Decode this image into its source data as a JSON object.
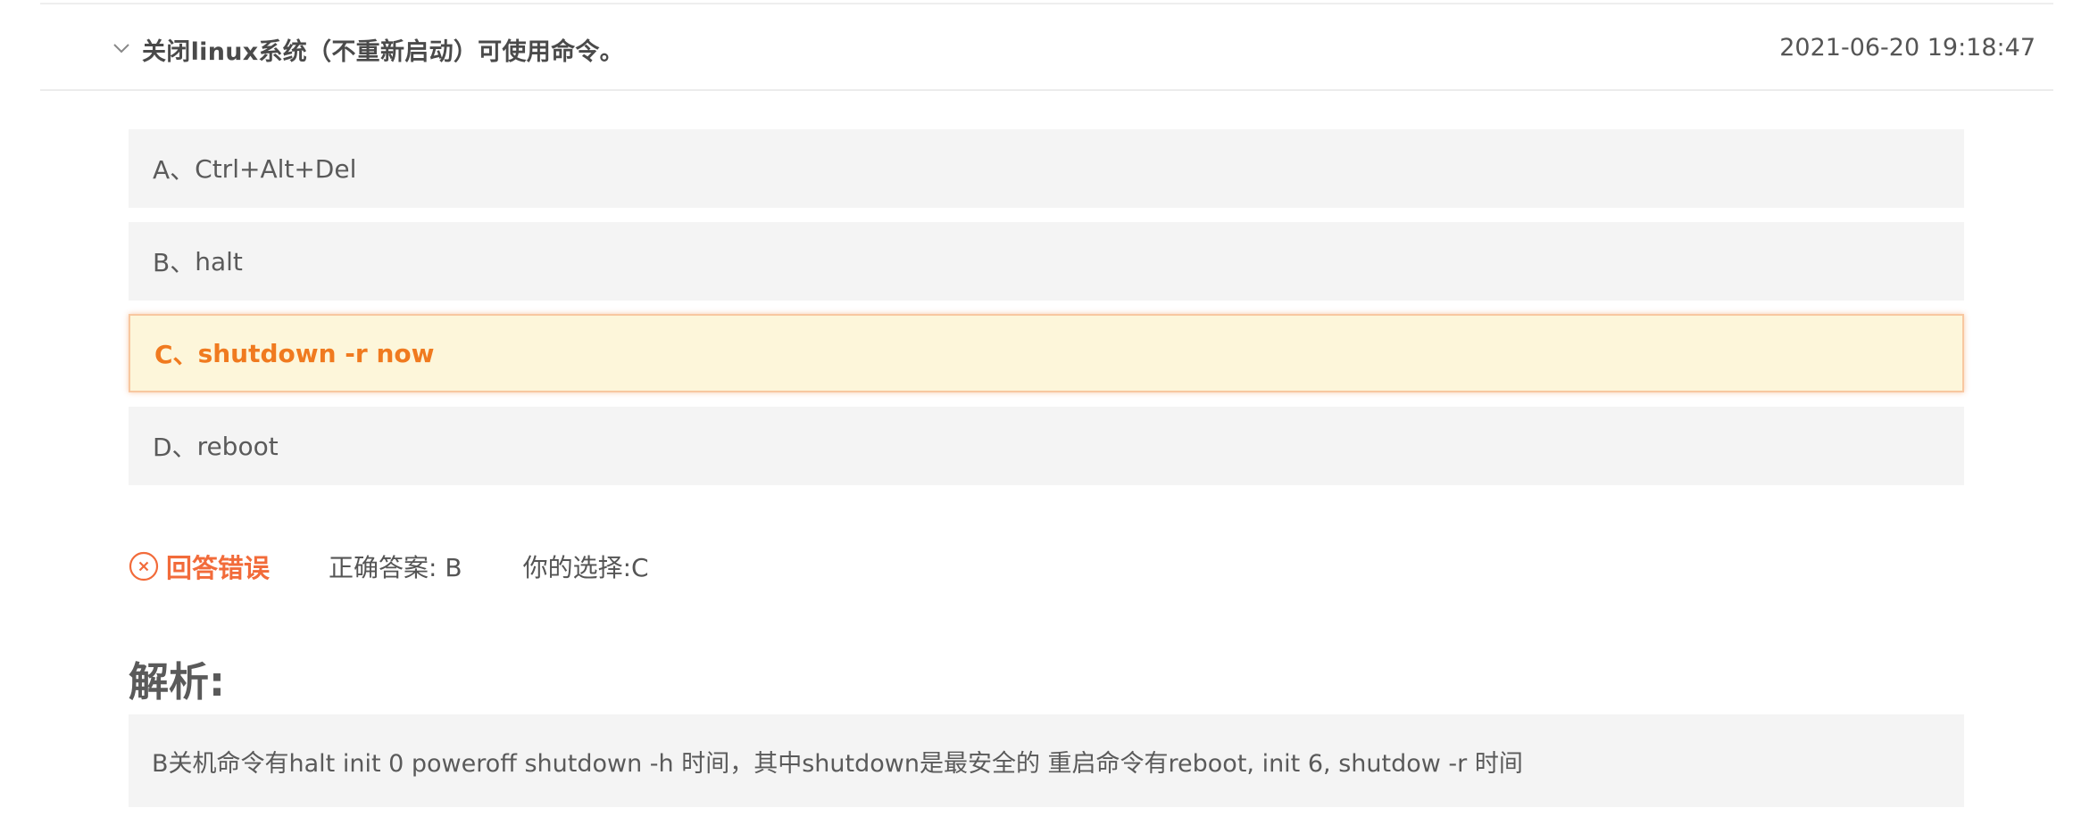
{
  "question": {
    "text": "关闭linux系统（不重新启动）可使用命令。",
    "timestamp": "2021-06-20 19:18:47",
    "expand_icon": "chevron-down-icon"
  },
  "options": [
    {
      "letter": "A、",
      "text": "Ctrl+Alt+Del",
      "selected": false
    },
    {
      "letter": "B、",
      "text": "halt",
      "selected": false
    },
    {
      "letter": "C、",
      "text": "shutdown -r now",
      "selected": true
    },
    {
      "letter": "D、",
      "text": "reboot",
      "selected": false
    }
  ],
  "result": {
    "icon": "x-circle-icon",
    "status": "回答错误",
    "correct_answer": "正确答案: B",
    "your_choice": "你的选择:C"
  },
  "analysis": {
    "title": "解析:",
    "text": "B关机命令有halt init 0 poweroff shutdown -h 时间，其中shutdown是最安全的 重启命令有reboot, init 6, shutdow -r 时间"
  },
  "colors": {
    "accent_orange": "#f07a1f",
    "wrong_red": "#f26b3a",
    "selected_bg": "#fdf6da",
    "option_bg": "#f4f4f4"
  }
}
